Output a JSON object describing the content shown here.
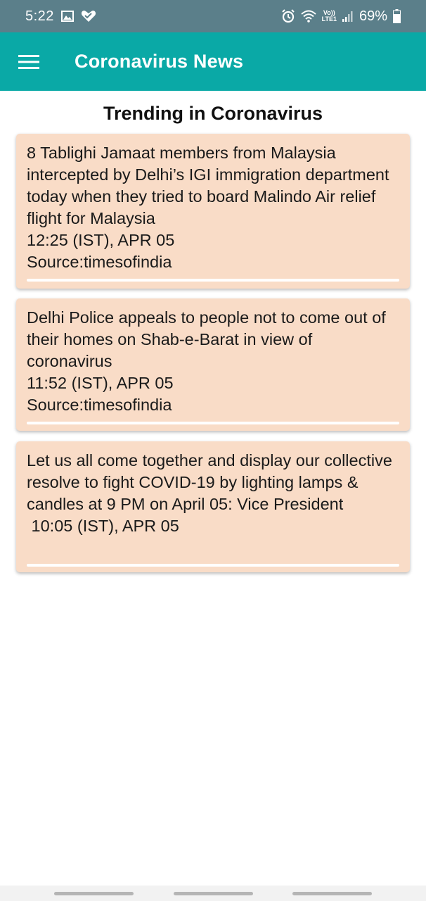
{
  "status_bar": {
    "time": "5:22",
    "left_icons": [
      "image-icon",
      "heart-check-icon"
    ],
    "volte": "Vo))",
    "lte": "LTE1",
    "battery": "69%",
    "bg_color": "#5b7f8a"
  },
  "app_bar": {
    "title": "Coronavirus News",
    "menu_icon": "hamburger-menu-icon",
    "color": "#0aa9a6"
  },
  "section": {
    "title": "Trending in Coronavirus"
  },
  "news": [
    {
      "headline": "8 Tablighi Jamaat members from Malaysia intercepted by Delhi’s IGI immigration department today when they tried to board Malindo Air relief flight for Malaysia",
      "time": "12:25 (IST), APR 05",
      "source": "Source:timesofindia"
    },
    {
      "headline": "Delhi Police appeals to people not to come out of their homes on Shab-e-Barat in view of coronavirus",
      "time": "11:52 (IST), APR 05",
      "source": "Source:timesofindia"
    },
    {
      "headline": "Let us all come together and display our collective resolve to fight COVID-19 by lighting lamps & candles at 9 PM on April 05: Vice President",
      "time": " 10:05 (IST), APR 05",
      "source": ""
    }
  ],
  "card_color": "#f9dcc7"
}
